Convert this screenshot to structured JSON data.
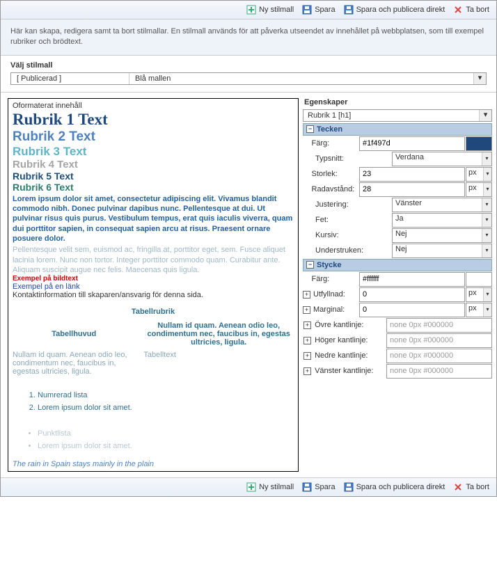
{
  "toolbar": {
    "new": "Ny stilmall",
    "save": "Spara",
    "publish": "Spara och publicera direkt",
    "delete": "Ta bort"
  },
  "description": "Här kan skapa, redigera samt ta bort stilmallar. En stilmall används för att påverka utseendet av innehållet på webbplatsen, som till exempel rubriker och brödtext.",
  "selector": {
    "label": "Välj stilmall",
    "status": "[ Publicerad ]",
    "value": "Blå mallen"
  },
  "preview": {
    "unformatted": "Oformaterat innehåll",
    "h1": "Rubrik 1 Text",
    "h2": "Rubrik 2 Text",
    "h3": "Rubrik 3 Text",
    "h4": "Rubrik 4 Text",
    "h5": "Rubrik 5 Text",
    "h6": "Rubrik 6 Text",
    "body": "Lorem ipsum dolor sit amet, consectetur adipiscing elit. Vivamus blandit commodo nibh. Donec pulvinar dapibus nunc. Pellentesque at dui. Ut pulvinar risus quis purus. Vestibulum tempus, erat quis iaculis viverra, quam dui porttitor sapien, in consequat sapien arcu at risus. Praesent ornare posuere dolor.",
    "muted": "Pellentesque velit sem, euismod ac, fringilla at, porttitor eget, sem. Fusce aliquet lacinia lorem. Nunc non tortor. Integer porttitor commodo quam. Curabitur ante. Aliquam suscipit augue nec felis. Maecenas quis ligula.",
    "caption": "Exempel på bildtext",
    "link": "Exempel på en länk",
    "contact": "Kontaktinformation till skaparen/ansvarig för denna sida.",
    "tableHeader": "Tabellrubrik",
    "tableHead": "Tabellhuvud",
    "tableCellA": "Nullam id quam. Aenean odio leo, condimentum nec, faucibus in, egestas ultricies, ligula.",
    "tableCellB": "Nullam id quam. Aenean odio leo, condimentum nec, faucibus in, egestas ultricies, ligula.",
    "tableText": "Tabelltext",
    "ol1": "Numrerad lista",
    "ol2": "Lorem ipsum dolor sit amet.",
    "ul1": "Punktlista",
    "ul2": "Lorem ipsum dolor sit amet.",
    "footer": "The rain in Spain stays mainly in the plain"
  },
  "props": {
    "title": "Egenskaper",
    "element": "Rubrik 1 [h1]",
    "groups": {
      "tecken": "Tecken",
      "stycke": "Stycke"
    },
    "tecken": {
      "farg": {
        "label": "Färg:",
        "value": "#1f497d"
      },
      "typsnitt": {
        "label": "Typsnitt:",
        "value": "Verdana"
      },
      "storlek": {
        "label": "Storlek:",
        "value": "23",
        "unit": "px"
      },
      "radavstand": {
        "label": "Radavstånd:",
        "value": "28",
        "unit": "px"
      },
      "justering": {
        "label": "Justering:",
        "value": "Vänster"
      },
      "fet": {
        "label": "Fet:",
        "value": "Ja"
      },
      "kursiv": {
        "label": "Kursiv:",
        "value": "Nej"
      },
      "understruken": {
        "label": "Understruken:",
        "value": "Nej"
      }
    },
    "stycke": {
      "farg": {
        "label": "Färg:",
        "value": "#ffffff"
      },
      "utfyllnad": {
        "label": "Utfyllnad:",
        "value": "0",
        "unit": "px"
      },
      "marginal": {
        "label": "Marginal:",
        "value": "0",
        "unit": "px"
      },
      "ovre": {
        "label": "Övre kantlinje:",
        "value": "none 0px #000000"
      },
      "hoger": {
        "label": "Höger kantlinje:",
        "value": "none 0px #000000"
      },
      "nedre": {
        "label": "Nedre kantlinje:",
        "value": "none 0px #000000"
      },
      "vanster": {
        "label": "Vänster kantlinje:",
        "value": "none 0px #000000"
      }
    }
  }
}
